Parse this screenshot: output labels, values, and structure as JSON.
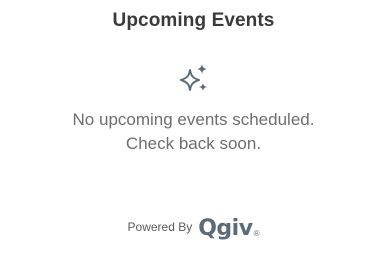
{
  "widget": {
    "title": "Upcoming Events",
    "empty_icon": "sparkle-icon",
    "empty_line1": "No upcoming events scheduled.",
    "empty_line2": "Check back soon."
  },
  "footer": {
    "powered_by": "Powered By",
    "brand": "Qgiv",
    "registered_mark": "®",
    "brand_color": "#5d6b78"
  },
  "colors": {
    "title": "#3a3a3a",
    "message": "#6e6e6e",
    "icon": "#5d6b78"
  }
}
